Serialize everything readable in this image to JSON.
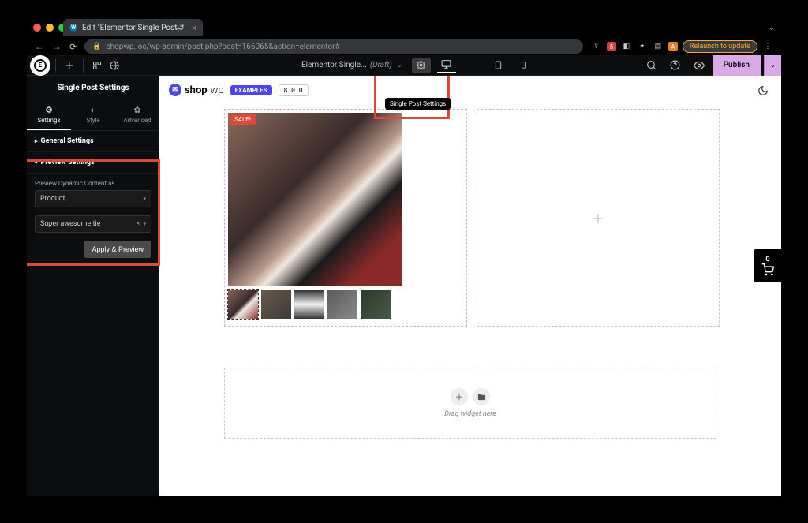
{
  "browser": {
    "tab_title": "Edit \"Elementor Single Post #",
    "url": "shopwp.loc/wp-admin/post.php?post=166065&action=elementor#",
    "relaunch": "Relaunch to update",
    "ext_5": "5",
    "ext_a": "A"
  },
  "toolbar": {
    "doc_title": "Elementor Single...",
    "draft": "(Draft)",
    "publish": "Publish"
  },
  "sidebar": {
    "title": "Single Post Settings",
    "tabs": {
      "settings": "Settings",
      "style": "Style",
      "advanced": "Advanced"
    },
    "general_hdr": "General Settings",
    "preview_hdr": "Preview Settings",
    "preview_as_label": "Preview Dynamic Content as",
    "preview_as_value": "Product",
    "preview_item": "Super awesome tie",
    "apply": "Apply & Preview"
  },
  "tooltip": "Single Post Settings",
  "shopwp": {
    "brand_a": "shop",
    "brand_b": "wp",
    "examples": "EXAMPLES",
    "version": "8.0.0"
  },
  "product": {
    "sale": "SALE!"
  },
  "dropzone": {
    "text": "Drag widget here"
  },
  "cart": {
    "count": "0"
  }
}
